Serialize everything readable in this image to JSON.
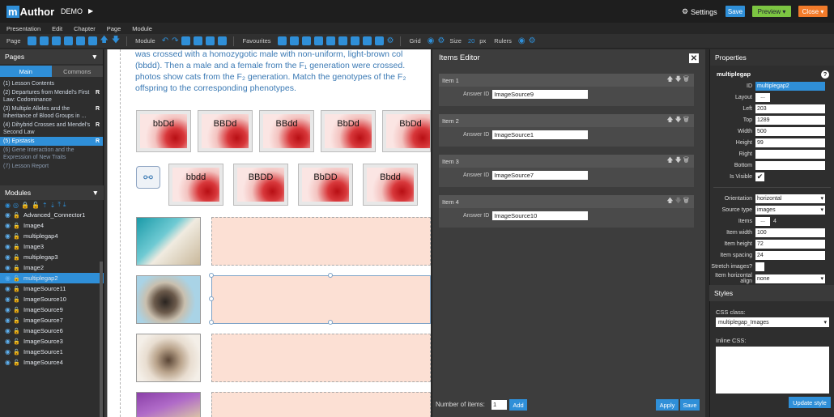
{
  "header": {
    "logo_m": "m",
    "logo_text": "Author",
    "logo_sub": "",
    "project": "DEMO",
    "settings": "Settings",
    "save": "Save",
    "preview": "Preview",
    "close": "Close"
  },
  "menu": [
    "Presentation",
    "Edit",
    "Chapter",
    "Page",
    "Module"
  ],
  "toolbar": {
    "page": "Page",
    "module": "Module",
    "favourites": "Favourites",
    "grid": "Grid",
    "size": "Size",
    "size_value": "20",
    "size_unit": "px",
    "rulers": "Rulers"
  },
  "pages_panel": {
    "title": "Pages",
    "tab_main": "Main",
    "tab_commons": "Commons",
    "items": [
      "(1) Lesson Contents",
      "(2) Departures from Mendel's First Law: Codominance",
      "(3) Multiple Alleles and the Inheritance of Blood Groups in ...",
      "(4) Dihybrid Crosses and Mendel's Second Law",
      "(5) Epistasis",
      "(6) Gene Interaction and the Expression of New Traits",
      "(7) Lesson Report"
    ],
    "flag": "R"
  },
  "modules_panel": {
    "title": "Modules",
    "items": [
      "Advanced_Connector1",
      "Image4",
      "multiplegap4",
      "Image3",
      "multiplegap3",
      "Image2",
      "multiplegap2",
      "ImageSource11",
      "ImageSource10",
      "ImageSource9",
      "ImageSource7",
      "ImageSource6",
      "ImageSource3",
      "ImageSource1",
      "ImageSource4"
    ]
  },
  "canvas": {
    "paragraph": "was crossed with a homozygotic male with non-uniform, light-brown col\n(bbdd). Then a male and a female from the F₁ generation were crossed.\nphotos show cats from the F₂ generation. Match the genotypes of the F₂\noffspring to the corresponding phenotypes.",
    "row1": [
      "bbDd",
      "BBDd",
      "BBdd",
      "BbDd",
      "BbDd"
    ],
    "row2": [
      "bbdd",
      "BBDD",
      "BbDD",
      "Bbdd"
    ]
  },
  "items_editor": {
    "title": "Items Editor",
    "close": "✕",
    "answer_label": "Answer ID",
    "items": [
      {
        "name": "Item 1",
        "answer": "ImageSource9"
      },
      {
        "name": "Item 2",
        "answer": "ImageSource1"
      },
      {
        "name": "Item 3",
        "answer": "ImageSource7"
      },
      {
        "name": "Item 4",
        "answer": "ImageSource10"
      }
    ],
    "number_label": "Number of items:",
    "number_value": "1",
    "add": "Add",
    "apply": "Apply",
    "save": "Save"
  },
  "properties": {
    "title": "Properties",
    "module_name": "multiplegap",
    "help": "?",
    "id_label": "ID",
    "id": "multiplegap2",
    "layout_label": "Layout",
    "layout": "...",
    "left_label": "Left",
    "left": "203",
    "top_label": "Top",
    "top": "1289",
    "width_label": "Width",
    "width": "500",
    "height_label": "Height",
    "height": "99",
    "right_label": "Right",
    "bottom_label": "Bottom",
    "visible_label": "Is Visible",
    "orientation_label": "Orientation",
    "orientation": "horizontal",
    "source_label": "Source type",
    "source": "images",
    "items_label": "Items",
    "items_count": "4",
    "item_width_label": "Item width",
    "item_width": "100",
    "item_height_label": "Item height",
    "item_height": "72",
    "item_spacing_label": "Item spacing",
    "item_spacing": "24",
    "stretch_label": "Stretch images?",
    "halign_label": "Item horizontal align",
    "halign": "none"
  },
  "styles": {
    "title": "Styles",
    "css_label": "CSS class:",
    "css_value": "multiplegap_Images",
    "inline_label": "Inline CSS:",
    "update": "Update style"
  },
  "colors": {
    "accent": "#2f8fd8",
    "preview": "#7cc542",
    "close": "#f27b2a",
    "drop_zone": "#fce0d4"
  }
}
